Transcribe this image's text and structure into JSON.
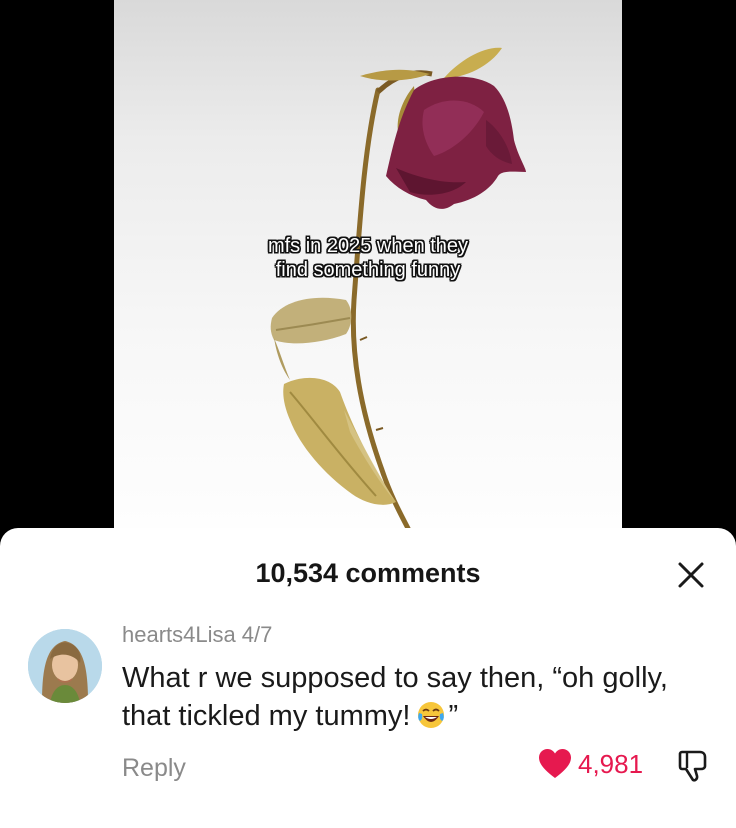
{
  "video": {
    "caption_line1": "mfs in 2025 when they",
    "caption_line2": "find something funny"
  },
  "comments_panel": {
    "count_label": "10,534 comments",
    "close_icon": "close-icon"
  },
  "comment": {
    "username": "hearts4Lisa",
    "date": "4/7",
    "text_part1": "What r we supposed to say then, “oh golly, that tickled my tummy!",
    "text_part2": "”",
    "emoji": "tears-of-joy-emoji",
    "reply_label": "Reply",
    "like_count": "4,981",
    "liked": true
  },
  "colors": {
    "like_red": "#e6194f",
    "muted_gray": "#8a8a8a",
    "text_dark": "#1a1a1a"
  }
}
